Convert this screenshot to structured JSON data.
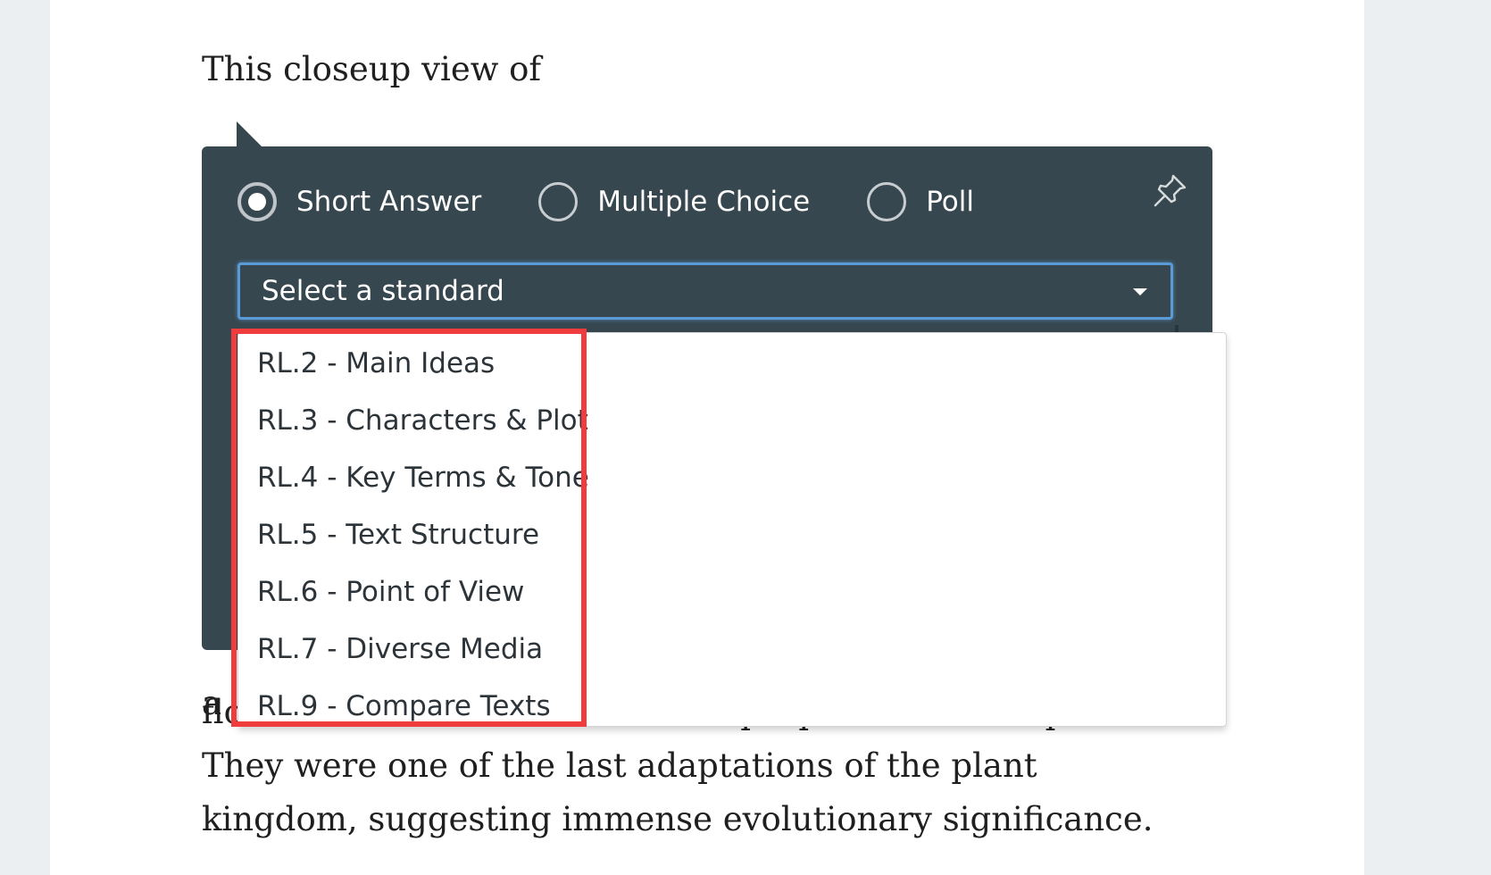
{
  "article": {
    "intro": "This closeup view of",
    "fragment": "a",
    "body": "flowers so colorful? What is the purpose of all the parts? They were one of the last adaptations of the plant kingdom, suggesting immense evolutionary significance."
  },
  "question_panel": {
    "types": [
      {
        "label": "Short Answer",
        "selected": true
      },
      {
        "label": "Multiple Choice",
        "selected": false
      },
      {
        "label": "Poll",
        "selected": false
      }
    ],
    "pin_icon": "pin-icon",
    "standard_select": {
      "placeholder": "Select a standard",
      "options": [
        "RL.2 - Main Ideas",
        "RL.3 - Characters & Plot",
        "RL.4 - Key Terms & Tone",
        "RL.5 - Text Structure",
        "RL.6 - Point of View",
        "RL.7 - Diverse Media",
        "RL.9 - Compare Texts"
      ]
    }
  },
  "colors": {
    "panel_bg": "#37474f",
    "select_focus_border": "#5b9bd5",
    "highlight_border": "#f03c3c",
    "page_bg": "#eceff2"
  }
}
